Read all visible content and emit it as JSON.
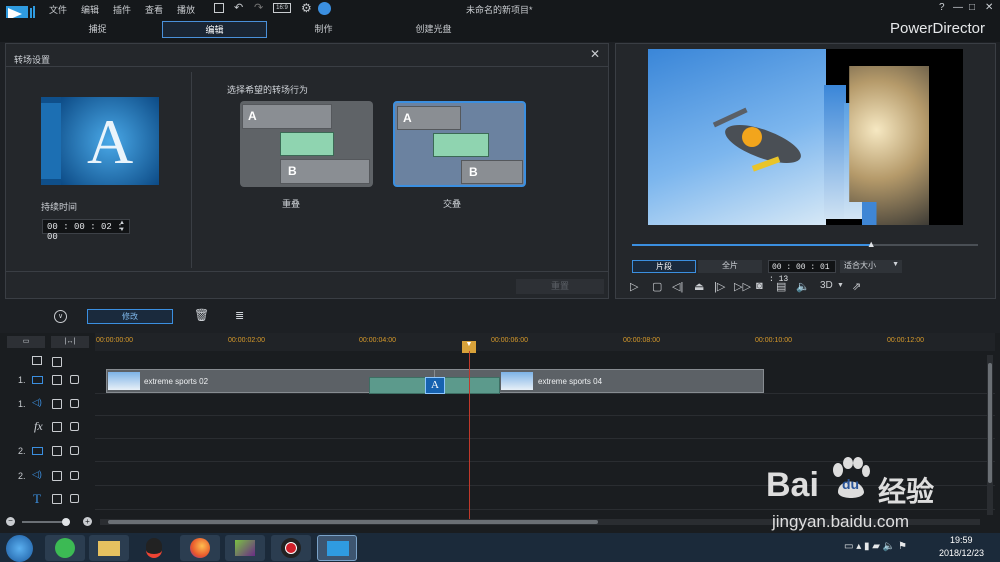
{
  "app": {
    "title": "未命名的新项目*",
    "brand": "PowerDirector",
    "menu": [
      "文件",
      "编辑",
      "插件",
      "查看",
      "播放"
    ],
    "win_controls": [
      "?",
      "—",
      "□",
      "✕"
    ]
  },
  "modes": [
    {
      "label": "捕捉",
      "active": false
    },
    {
      "label": "编辑",
      "active": true
    },
    {
      "label": "制作",
      "active": false
    },
    {
      "label": "创建光盘",
      "active": false
    }
  ],
  "panel": {
    "title": "转场设置",
    "duration_label": "持续时间",
    "duration_value": "00 : 00 : 02 : 00",
    "behavior_label": "选择希望的转场行为",
    "options": [
      {
        "label": "重叠",
        "a": "A",
        "b": "B",
        "selected": false
      },
      {
        "label": "交叠",
        "a": "A",
        "b": "B",
        "selected": true
      }
    ],
    "reset_label": "重置",
    "thumb_letter": "A"
  },
  "preview": {
    "tab_clip": "片段",
    "tab_full": "全片",
    "timecode": "00 : 00 : 01 : 13",
    "fit": "适合大小",
    "mode_3d": "3D",
    "progress": 0.69
  },
  "toolbar": {
    "modify_label": "修改"
  },
  "timeline": {
    "ticks": [
      "00:00:00:00",
      "00:00:02:00",
      "00:00:04:00",
      "00:00:06:00",
      "00:00:08:00",
      "00:00:10:00",
      "00:00:12:00"
    ],
    "tracks": [
      {
        "label": "1.",
        "type": "video"
      },
      {
        "label": "1.",
        "type": "audio"
      },
      {
        "label": "fx",
        "type": "fx"
      },
      {
        "label": "2.",
        "type": "video"
      },
      {
        "label": "2.",
        "type": "audio"
      },
      {
        "label": "T",
        "type": "title"
      }
    ],
    "clips": [
      {
        "name": "extreme sports 02"
      },
      {
        "name": "extreme sports 04"
      }
    ],
    "transition_letter": "A"
  },
  "taskbar": {
    "time": "19:59",
    "date": "2018/12/23"
  },
  "watermark": {
    "brand": "Bai",
    "brand2": "du",
    "cn": "经验",
    "url": "jingyan.baidu.com"
  },
  "colors": {
    "accent": "#3b8fe0",
    "transition_green": "#8fd4b0",
    "playhead": "#c0392b",
    "tick_orange": "#d79a2a"
  }
}
